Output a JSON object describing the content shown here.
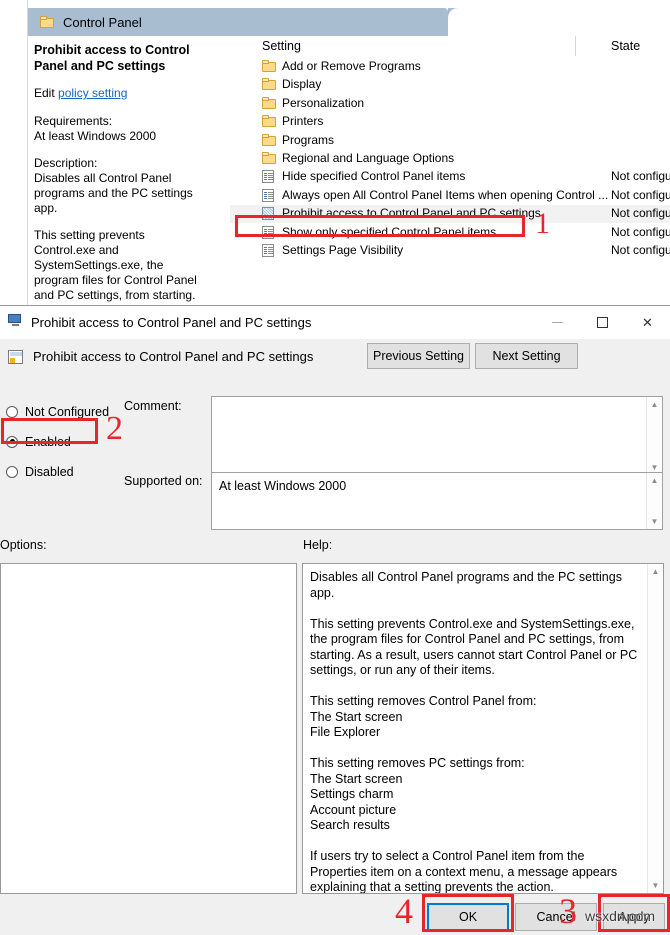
{
  "colors": {
    "annotation_red": "#e8262a",
    "tab_header_blue": "#a9bdd0",
    "link_blue": "#1566c0",
    "focus_blue": "#0078d7",
    "dialog_gray": "#f0f0f0"
  },
  "gpedit": {
    "tab": {
      "label": "Control Panel",
      "icon": "folder-icon"
    },
    "description_pane": {
      "title": "Prohibit access to Control Panel and PC settings",
      "edit_prefix": "Edit ",
      "edit_link": "policy setting",
      "requirements_label": "Requirements:",
      "requirements_value": "At least Windows 2000",
      "description_label": "Description:",
      "description_text": "Disables all Control Panel programs and the PC settings app.",
      "description_text2": "This setting prevents Control.exe and SystemSettings.exe, the program files for Control Panel and PC settings, from starting. As a result, users cannot start Control"
    },
    "list": {
      "columns": {
        "setting": "Setting",
        "state": "State"
      },
      "rows": [
        {
          "name": "Add or Remove Programs",
          "state": "",
          "icon": "folder-icon",
          "selected": false
        },
        {
          "name": "Display",
          "state": "",
          "icon": "folder-icon",
          "selected": false
        },
        {
          "name": "Personalization",
          "state": "",
          "icon": "folder-icon",
          "selected": false
        },
        {
          "name": "Printers",
          "state": "",
          "icon": "folder-icon",
          "selected": false
        },
        {
          "name": "Programs",
          "state": "",
          "icon": "folder-icon",
          "selected": false
        },
        {
          "name": "Regional and Language Options",
          "state": "",
          "icon": "folder-icon",
          "selected": false
        },
        {
          "name": "Hide specified Control Panel items",
          "state": "Not configured",
          "icon": "policy-doc-icon",
          "selected": false
        },
        {
          "name": "Always open All Control Panel Items when opening Control ...",
          "state": "Not configured",
          "icon": "policy-doc-icon",
          "selected": false
        },
        {
          "name": "Prohibit access to Control Panel and PC settings",
          "state": "Not configured",
          "icon": "policy-doc-icon",
          "selected": true
        },
        {
          "name": "Show only specified Control Panel items",
          "state": "Not configured",
          "icon": "policy-doc-icon",
          "selected": false
        },
        {
          "name": "Settings Page Visibility",
          "state": "Not configured",
          "icon": "policy-doc-icon",
          "selected": false
        }
      ]
    }
  },
  "dialog": {
    "titlebar": {
      "title": "Prohibit access to Control Panel and PC settings",
      "icon": "policy-editor-icon",
      "minimize": "—",
      "maximize": "□",
      "close": "✕"
    },
    "header": {
      "title": "Prohibit access to Control Panel and PC settings",
      "previous_setting": "Previous Setting",
      "next_setting": "Next Setting"
    },
    "state_options": [
      {
        "label": "Not Configured",
        "selected": false
      },
      {
        "label": "Enabled",
        "selected": true
      },
      {
        "label": "Disabled",
        "selected": false
      }
    ],
    "comment": {
      "label": "Comment:",
      "value": ""
    },
    "supported_on": {
      "label": "Supported on:",
      "value": "At least Windows 2000"
    },
    "options": {
      "label": "Options:",
      "value": ""
    },
    "help": {
      "label": "Help:",
      "text": "Disables all Control Panel programs and the PC settings app.\n\nThis setting prevents Control.exe and SystemSettings.exe, the program files for Control Panel and PC settings, from starting. As a result, users cannot start Control Panel or PC settings, or run any of their items.\n\nThis setting removes Control Panel from:\nThe Start screen\nFile Explorer\n\nThis setting removes PC settings from:\nThe Start screen\nSettings charm\nAccount picture\nSearch results\n\nIf users try to select a Control Panel item from the Properties item on a context menu, a message appears explaining that a setting prevents the action."
    },
    "buttons": {
      "ok": "OK",
      "cancel": "Cancel",
      "apply": "Apply"
    }
  },
  "annotations": {
    "step1": "1",
    "step2": "2",
    "step3": "3",
    "step4": "4"
  },
  "watermark": "wsxdn.com"
}
